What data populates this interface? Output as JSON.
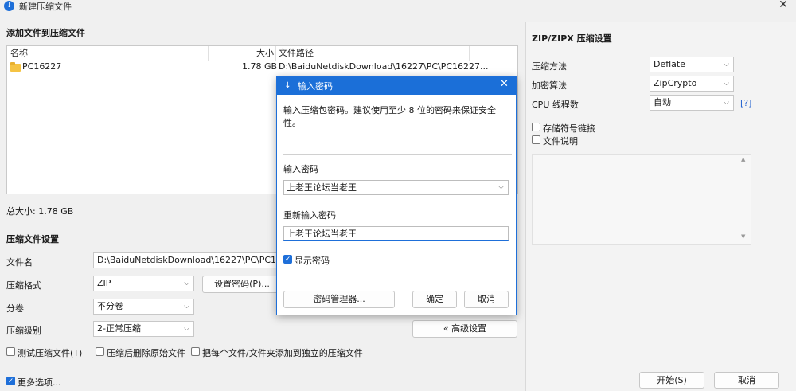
{
  "window": {
    "title": "新建压缩文件",
    "close_glyph": "✕"
  },
  "files": {
    "section_title": "添加文件到压缩文件",
    "columns": {
      "name": "名称",
      "size": "大小",
      "path": "文件路径"
    },
    "rows": [
      {
        "name": "PC16227",
        "size": "1.78 GB",
        "path": "D:\\BaiduNetdiskDownload\\16227\\PC\\PC16227..."
      }
    ],
    "total_label": "总大小: 1.78 GB"
  },
  "archive": {
    "section_title": "压缩文件设置",
    "filename_label": "文件名",
    "filename_value": "D:\\BaiduNetdiskDownload\\16227\\PC\\PC16227",
    "format_label": "压缩格式",
    "format_value": "ZIP",
    "set_password_button": "设置密码(P)...",
    "split_label": "分卷",
    "split_value": "不分卷",
    "level_label": "压缩级别",
    "level_value": "2-正常压缩",
    "advanced_button": "« 高级设置",
    "opt_test": "测试压缩文件(T)",
    "opt_delete": "压缩后删除原始文件",
    "opt_each": "把每个文件/文件夹添加到独立的压缩文件",
    "more_options": "更多选项..."
  },
  "footer": {
    "start_button": "开始(S)",
    "cancel_button": "取消"
  },
  "zip_settings": {
    "title": "ZIP/ZIPX 压缩设置",
    "method_label": "压缩方法",
    "method_value": "Deflate",
    "encryption_label": "加密算法",
    "encryption_value": "ZipCrypto",
    "cpu_label": "CPU 线程数",
    "cpu_value": "自动",
    "help_link": "[?]",
    "opt_symlink": "存储符号链接",
    "opt_comment": "文件说明"
  },
  "password_dialog": {
    "title": "输入密码",
    "description": "输入压缩包密码。建议使用至少 8 位的密码来保证安全性。",
    "enter_label": "输入密码",
    "enter_value": "上老王论坛当老王",
    "reenter_label": "重新输入密码",
    "reenter_value": "上老王论坛当老王",
    "show_password": "显示密码",
    "manager_button": "密码管理器...",
    "ok_button": "确定",
    "cancel_button": "取消"
  },
  "glyphs": {
    "chevron": "⌵",
    "check": "✓",
    "arrow_up": "▲",
    "arrow_down": "▼"
  },
  "colors": {
    "accent": "#1e6fd9",
    "dialog_title_bg": "#1b6fd8"
  }
}
